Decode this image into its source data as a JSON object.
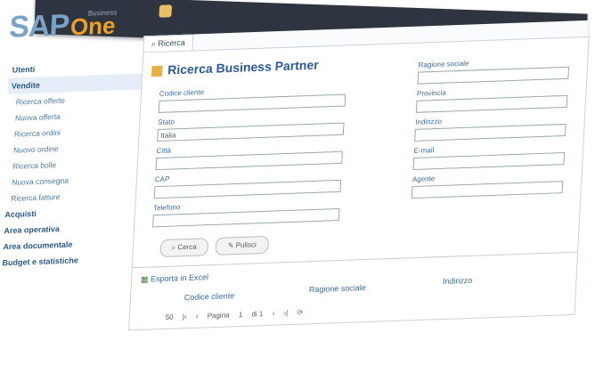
{
  "logo": {
    "brand": "SAP",
    "product": "One",
    "tagline": "Business"
  },
  "sidebar": {
    "items": [
      {
        "label": "Utenti"
      },
      {
        "label": "Vendite"
      },
      {
        "label": "Ricerca offerte"
      },
      {
        "label": "Nuova offerta"
      },
      {
        "label": "Ricerca ordini"
      },
      {
        "label": "Nuovo ordine"
      },
      {
        "label": "Ricerca bolle"
      },
      {
        "label": "Nuova consegna"
      },
      {
        "label": "Ricerca fatture"
      },
      {
        "label": "Acquisti"
      },
      {
        "label": "Area operativa"
      },
      {
        "label": "Area documentale"
      },
      {
        "label": "Budget e statistiche"
      }
    ]
  },
  "tab": {
    "label": "Ricerca"
  },
  "panel": {
    "title": "Ricerca Business Partner",
    "left_fields": [
      {
        "label": "Codice cliente",
        "value": ""
      },
      {
        "label": "Stato",
        "value": "Italia"
      },
      {
        "label": "Città",
        "value": ""
      },
      {
        "label": "CAP",
        "value": ""
      },
      {
        "label": "Telefono",
        "value": ""
      }
    ],
    "right_fields": [
      {
        "label": "Ragione sociale",
        "value": ""
      },
      {
        "label": "Provincia",
        "value": ""
      },
      {
        "label": "Indirizzo",
        "value": ""
      },
      {
        "label": "E-mail",
        "value": ""
      },
      {
        "label": "Agente",
        "value": ""
      }
    ],
    "buttons": {
      "search": "Cerca",
      "clear": "Pulisci"
    }
  },
  "results": {
    "export_label": "Esporta in Excel",
    "columns": [
      "Codice cliente",
      "Ragione sociale",
      "Indirizzo"
    ],
    "pager": {
      "page_size": "50",
      "page_label": "Pagina",
      "page_number": "1",
      "of_label": "di 1"
    }
  }
}
